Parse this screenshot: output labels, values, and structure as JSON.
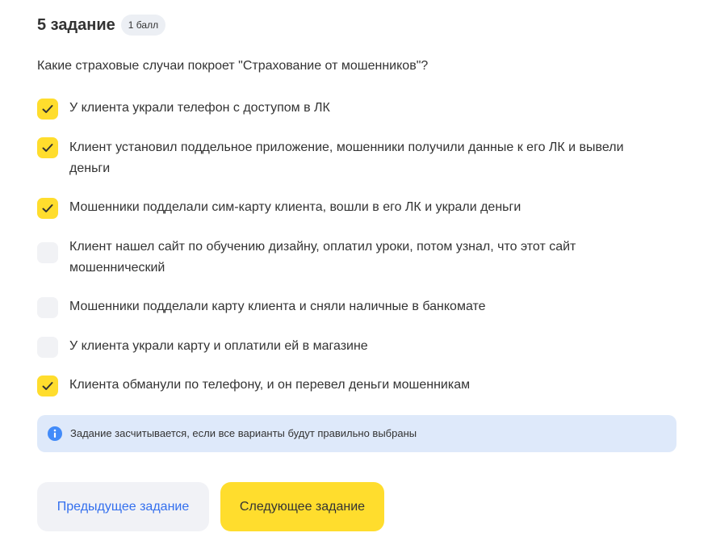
{
  "task": {
    "title": "5 задание",
    "points_badge": "1 балл",
    "question": "Какие страховые случаи покроет \"Страхование от мошенников\"?"
  },
  "options": [
    {
      "label": "У клиента украли телефон с доступом в ЛК",
      "checked": true
    },
    {
      "label": "Клиент установил поддельное приложение, мошенники получили данные к его ЛК и вывели деньги",
      "checked": true
    },
    {
      "label": "Мошенники подделали сим-карту клиента, вошли в его ЛК и украли деньги",
      "checked": true
    },
    {
      "label": "Клиент нашел сайт по обучению дизайну, оплатил уроки, потом узнал, что этот сайт мошеннический",
      "checked": false
    },
    {
      "label": "Мошенники подделали карту клиента и сняли наличные в банкомате",
      "checked": false
    },
    {
      "label": "У клиента украли карту и оплатили ей в магазине",
      "checked": false
    },
    {
      "label": "Клиента обманули по телефону, и он перевел деньги мошенникам",
      "checked": true
    }
  ],
  "info": {
    "icon": "info-icon",
    "text": "Задание засчитывается, если все варианты будут правильно выбраны"
  },
  "buttons": {
    "prev_label": "Предыдущее задание",
    "next_label": "Следующее задание"
  },
  "colors": {
    "accent_yellow": "#ffdd2d",
    "checkbox_unchecked": "#f1f2f5",
    "info_background": "#dee9fa",
    "info_icon": "#428bf9",
    "link_blue": "#336fee",
    "text": "#333333"
  }
}
